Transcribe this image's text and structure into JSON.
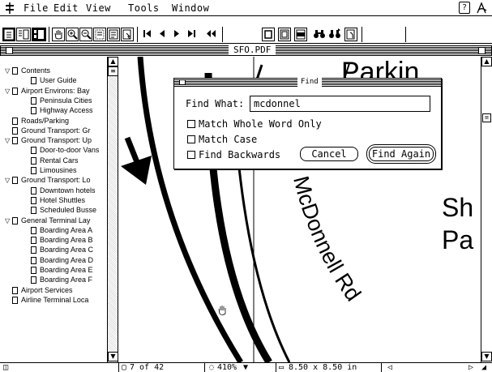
{
  "menubar": {
    "menus": [
      "File",
      "Edit",
      "View",
      "Tools",
      "Window"
    ],
    "help_label": "?"
  },
  "toolbar": {
    "buttons": [
      "page-only",
      "bookmarks-and-page",
      "thumbnails-and-page",
      "hand-tool",
      "zoom-in",
      "zoom-out",
      "text-select",
      "column-select",
      "link",
      "first-page",
      "previous-page",
      "next-page",
      "last-page",
      "go-back",
      "actual-size",
      "fit-page",
      "fit-width",
      "find",
      "find-again",
      "acrobat"
    ]
  },
  "window": {
    "title": "SFO.PDF"
  },
  "sidebar": {
    "bookmarks": [
      {
        "label": "Contents",
        "expanded": true,
        "indent": 0
      },
      {
        "label": "User Guide",
        "indent": 1
      },
      {
        "label": "Airport Environs: Bay",
        "expanded": true,
        "indent": 0
      },
      {
        "label": "Peninsula Cities",
        "indent": 1
      },
      {
        "label": "Highway Access",
        "indent": 1
      },
      {
        "label": "Roads/Parking",
        "indent": 0
      },
      {
        "label": "Ground Transport: Gr",
        "indent": 0
      },
      {
        "label": "Ground Transport: Up",
        "expanded": true,
        "indent": 0
      },
      {
        "label": "Door-to-door Vans",
        "indent": 1
      },
      {
        "label": "Rental Cars",
        "indent": 1
      },
      {
        "label": "Limousines",
        "indent": 1
      },
      {
        "label": "Ground Transport: Lo",
        "expanded": true,
        "indent": 0
      },
      {
        "label": "Downtown hotels",
        "indent": 1
      },
      {
        "label": "Hotel Shuttles",
        "indent": 1
      },
      {
        "label": "Scheduled Busse",
        "indent": 1
      },
      {
        "label": "General Terminal Lay",
        "expanded": true,
        "indent": 0
      },
      {
        "label": "Boarding Area A",
        "indent": 1
      },
      {
        "label": "Boarding Area B",
        "indent": 1
      },
      {
        "label": "Boarding Area C",
        "indent": 1
      },
      {
        "label": "Boarding Area D",
        "indent": 1
      },
      {
        "label": "Boarding Area E",
        "indent": 1
      },
      {
        "label": "Boarding Area F",
        "indent": 1
      },
      {
        "label": "Airport Services",
        "indent": 0
      },
      {
        "label": "Airline Terminal Loca",
        "indent": 0
      }
    ]
  },
  "document": {
    "text_parkin": "Parkin",
    "text_sh": "Sh",
    "text_pa": "Pa",
    "road_label": "McDonnell Rd"
  },
  "find_dialog": {
    "title": "Find",
    "find_what_label": "Find What:",
    "find_what_value": "mcdonnel",
    "match_whole_word_label": "Match Whole Word Only",
    "match_whole_word_checked": false,
    "match_case_label": "Match Case",
    "match_case_checked": false,
    "find_backwards_label": "Find Backwards",
    "find_backwards_checked": false,
    "cancel_label": "Cancel",
    "find_again_label": "Find Again"
  },
  "statusbar": {
    "page": "7 of 42",
    "zoom": "410%",
    "page_size": "8.50 x 8.50 in"
  }
}
